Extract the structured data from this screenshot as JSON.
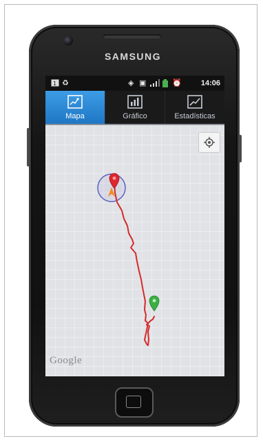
{
  "device": {
    "brand": "SAMSUNG"
  },
  "status_bar": {
    "time": "14:06",
    "icons": [
      "notification-icon",
      "recycle-icon",
      "gps-icon",
      "vibrate-icon",
      "signal-icon",
      "battery-icon",
      "alarm-icon"
    ],
    "battery_color": "#4caf50"
  },
  "tabs": [
    {
      "label": "Mapa",
      "icon": "map-icon",
      "active": true
    },
    {
      "label": "Gráfico",
      "icon": "bar-chart-icon",
      "active": false
    },
    {
      "label": "Estadísticas",
      "icon": "line-chart-icon",
      "active": false
    }
  ],
  "map": {
    "attribution": "Google",
    "route_color": "#d42a2a",
    "start_marker_color": "#3cb043",
    "end_marker_color": "#e0262e",
    "accuracy_circle_color": "#5b5fbf",
    "arrow_color": "#f28c1f"
  },
  "accent_color": "#2b8ad8"
}
